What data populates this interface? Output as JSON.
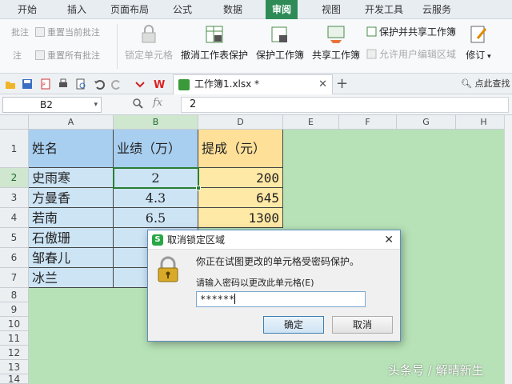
{
  "menu_tabs": [
    "开始",
    "插入",
    "页面布局",
    "公式",
    "数据",
    "审阅",
    "视图",
    "开发工具",
    "云服务"
  ],
  "active_tab": "审阅",
  "ribbon": {
    "small_items": [
      "批注",
      "重置当前批注",
      "注",
      "重置所有批注"
    ],
    "lock_cells": "锁定单元格",
    "unprotect_sheet": "撤消工作表保护",
    "protect_workbook": "保护工作簿",
    "share_workbook": "共享工作簿",
    "protect_share": "保护并共享工作簿",
    "allow_edit_ranges": "允许用户编辑区域",
    "track_changes": "修订"
  },
  "doc_tab": {
    "title": "工作簿1.xlsx *",
    "close": "✕"
  },
  "add_tab": "+",
  "search_hint": "点此查找",
  "formula_bar": {
    "name_box": "B2",
    "fx": "fx",
    "value": "2"
  },
  "grid": {
    "columns": [
      "A",
      "B",
      "D",
      "E",
      "F",
      "G",
      "H"
    ],
    "rows": [
      "1",
      "2",
      "3",
      "4",
      "5",
      "6",
      "7",
      "8",
      "9",
      "10",
      "11",
      "12",
      "13",
      "14"
    ],
    "header_row": [
      "姓名",
      "业绩（万）",
      "提成（元）"
    ],
    "data": [
      {
        "name": "史雨寒",
        "perf": "2",
        "comm": "200"
      },
      {
        "name": "方曼香",
        "perf": "4.3",
        "comm": "645"
      },
      {
        "name": "若南",
        "perf": "6.5",
        "comm": "1300"
      },
      {
        "name": "石傲珊",
        "perf": "",
        "comm": ""
      },
      {
        "name": "邹春儿",
        "perf": "",
        "comm": ""
      },
      {
        "name": "冰兰",
        "perf": "",
        "comm": ""
      }
    ]
  },
  "dialog": {
    "title": "取消锁定区域",
    "close": "✕",
    "message": "你正在试图更改的单元格受密码保护。",
    "label": "请输入密码以更改此单元格(E)",
    "password": "******",
    "ok": "确定",
    "cancel": "取消"
  },
  "watermark": "头条号 / 解晴新生",
  "colors": {
    "accent_green": "#2e8b57",
    "grid_bg": "#b7e2b7",
    "name_fill": "#cde4f5",
    "comm_fill": "#ffe9a6"
  }
}
